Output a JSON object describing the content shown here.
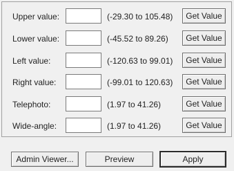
{
  "rows": [
    {
      "label": "Upper value:",
      "value": "",
      "range": "(-29.30 to 105.48)",
      "button": "Get Value"
    },
    {
      "label": "Lower value:",
      "value": "",
      "range": "(-45.52 to 89.26)",
      "button": "Get Value"
    },
    {
      "label": "Left value:",
      "value": "",
      "range": "(-120.63 to 99.01)",
      "button": "Get Value"
    },
    {
      "label": "Right value:",
      "value": "",
      "range": "(-99.01 to 120.63)",
      "button": "Get Value"
    },
    {
      "label": "Telephoto:",
      "value": "",
      "range": "(1.97 to 41.26)",
      "button": "Get Value"
    },
    {
      "label": "Wide-angle:",
      "value": "",
      "range": "(1.97 to 41.26)",
      "button": "Get Value"
    }
  ],
  "buttons": {
    "admin_viewer": "Admin Viewer...",
    "preview": "Preview",
    "apply": "Apply"
  }
}
